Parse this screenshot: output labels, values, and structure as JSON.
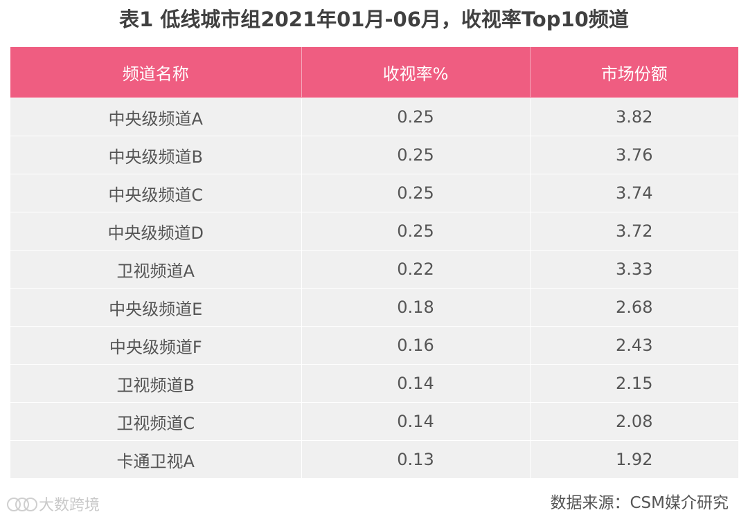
{
  "title": "表1  低线城市组2021年01月-06月，收视率Top10频道",
  "chart_data": {
    "type": "table",
    "columns": [
      "频道名称",
      "收视率%",
      "市场份额"
    ],
    "rows": [
      [
        "中央级频道A",
        "0.25",
        "3.82"
      ],
      [
        "中央级频道B",
        "0.25",
        "3.76"
      ],
      [
        "中央级频道C",
        "0.25",
        "3.74"
      ],
      [
        "中央级频道D",
        "0.25",
        "3.72"
      ],
      [
        "卫视频道A",
        "0.22",
        "3.33"
      ],
      [
        "中央级频道E",
        "0.18",
        "2.68"
      ],
      [
        "中央级频道F",
        "0.16",
        "2.43"
      ],
      [
        "卫视频道B",
        "0.14",
        "2.15"
      ],
      [
        "卫视频道C",
        "0.14",
        "2.08"
      ],
      [
        "卡通卫视A",
        "0.13",
        "1.92"
      ]
    ]
  },
  "footer": {
    "watermark": "大数跨境",
    "source": "数据来源：CSM媒介研究"
  },
  "colors": {
    "header_bg": "#ef5d81",
    "row_bg": "#f0f0f0"
  }
}
